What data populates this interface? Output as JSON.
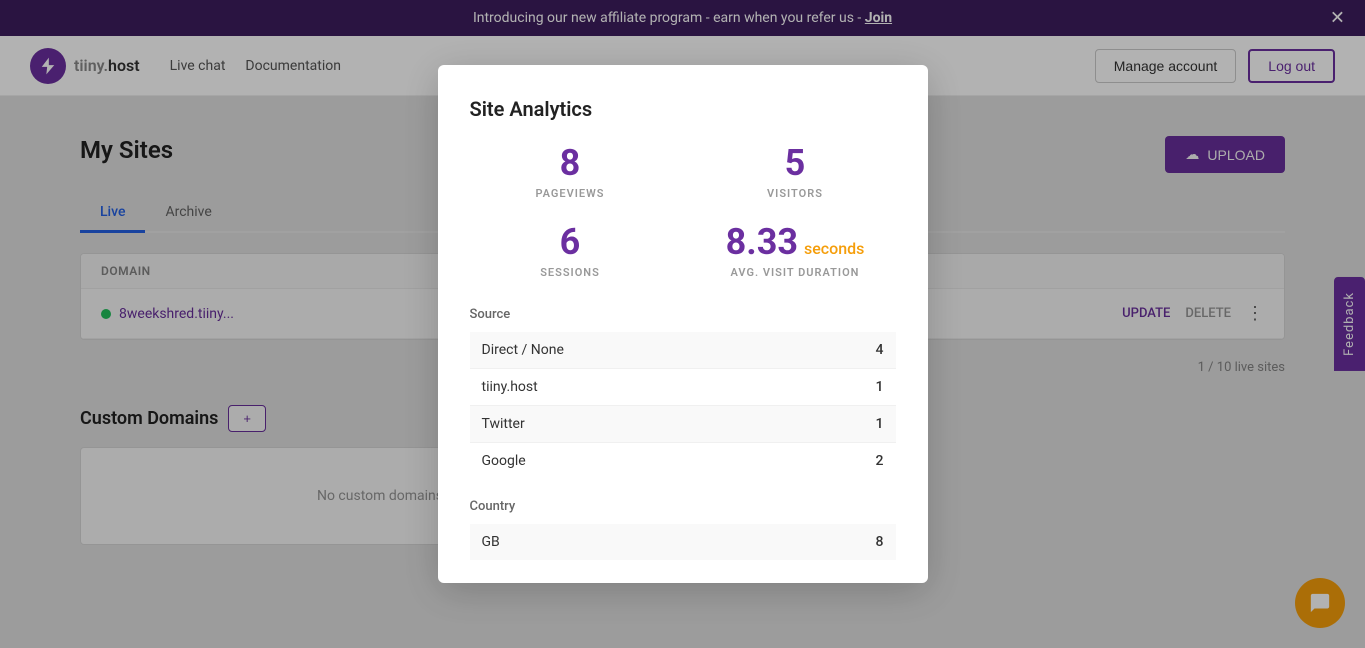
{
  "banner": {
    "text": "Introducing our new affiliate program - earn when you refer us -",
    "link_text": "Join"
  },
  "navbar": {
    "logo_text": "tiiny.host",
    "live_chat": "Live chat",
    "documentation": "Documentation",
    "manage_account": "Manage account",
    "log_out": "Log out"
  },
  "page": {
    "title": "My Sites",
    "upload_label": "UPLOAD"
  },
  "tabs": [
    {
      "label": "Live",
      "active": true
    },
    {
      "label": "Archive",
      "active": false
    }
  ],
  "table": {
    "domain_header": "DOMAIN",
    "row": {
      "domain": "8weekshred.tiiny...",
      "update": "UPDATE",
      "delete": "DELETE"
    },
    "pagination": "1 / 10 live sites"
  },
  "custom_domains": {
    "title": "Custom Domains",
    "add_label": "+",
    "empty_text": "No custom domains"
  },
  "feedback": {
    "label": "Feedback"
  },
  "modal": {
    "title": "Site Analytics",
    "stats": {
      "pageviews_value": "8",
      "pageviews_label": "PAGEVIEWS",
      "visitors_value": "5",
      "visitors_label": "VISITORS",
      "sessions_value": "6",
      "sessions_label": "SESSIONS",
      "avg_duration_value": "8.33",
      "avg_duration_unit": "seconds",
      "avg_duration_label": "AVG. VISIT DURATION"
    },
    "source_label": "Source",
    "sources": [
      {
        "name": "Direct / None",
        "count": 4
      },
      {
        "name": "tiiny.host",
        "count": 1
      },
      {
        "name": "Twitter",
        "count": 1
      },
      {
        "name": "Google",
        "count": 2
      }
    ],
    "country_label": "Country",
    "countries": [
      {
        "name": "GB",
        "count": 8
      }
    ]
  }
}
